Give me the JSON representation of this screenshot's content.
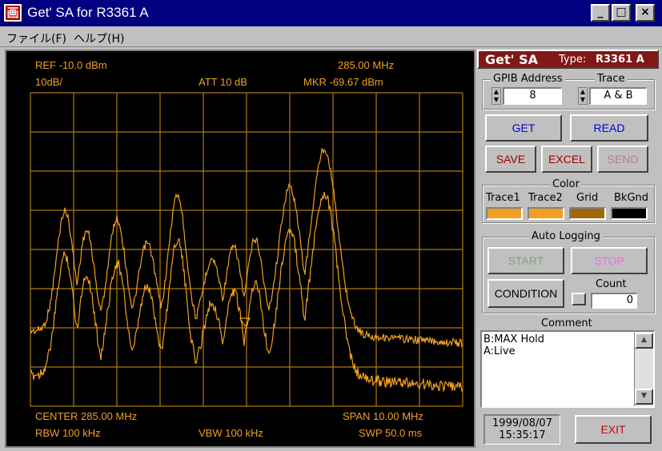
{
  "window": {
    "title": "Get' SA for R3361 A",
    "icon_glyph": "画",
    "min_glyph": "_",
    "max_glyph": "□",
    "close_glyph": "×"
  },
  "menu": {
    "file": "ファイル(F)",
    "help": "ヘルプ(H)"
  },
  "screen": {
    "ref": "REF -10.0 dBm",
    "scale": "10dB/",
    "att": "ATT 10 dB",
    "mkr_freq": "285.00 MHz",
    "mkr_level": "MKR -69.67 dBm",
    "center": "CENTER 285.00 MHz",
    "span": "SPAN 10.00 MHz",
    "rbw": "RBW 100 kHz",
    "vbw": "VBW 100 kHz",
    "swp": "SWP 50.0 ms",
    "trace_color": "#f0a020",
    "grid_color": "#b07810"
  },
  "panel": {
    "app_name": "Get' SA",
    "type_label": "Type:",
    "type_value": "R3361 A",
    "gpib_label": "GPIB Address",
    "gpib_value": "8",
    "trace_label": "Trace",
    "trace_value": "A & B",
    "get": "GET",
    "read": "READ",
    "save": "SAVE",
    "excel": "EXCEL",
    "send": "SEND",
    "color_label": "Color",
    "trace1": "Trace1",
    "trace2": "Trace2",
    "grid": "Grid",
    "bkgnd": "BkGnd",
    "trace1_color": "#f0a020",
    "trace2_color": "#f0a020",
    "grid_color": "#a06808",
    "bkgnd_color": "#000000",
    "auto_logging": "Auto Logging",
    "start": "START",
    "stop": "STOP",
    "condition": "CONDITION",
    "count_label": "Count",
    "count_value": "0",
    "comment_label": "Comment",
    "comment_line1": "B:MAX Hold",
    "comment_line2": "A:Live",
    "date": "1999/08/07",
    "time": "15:35:17",
    "exit": "EXIT"
  }
}
